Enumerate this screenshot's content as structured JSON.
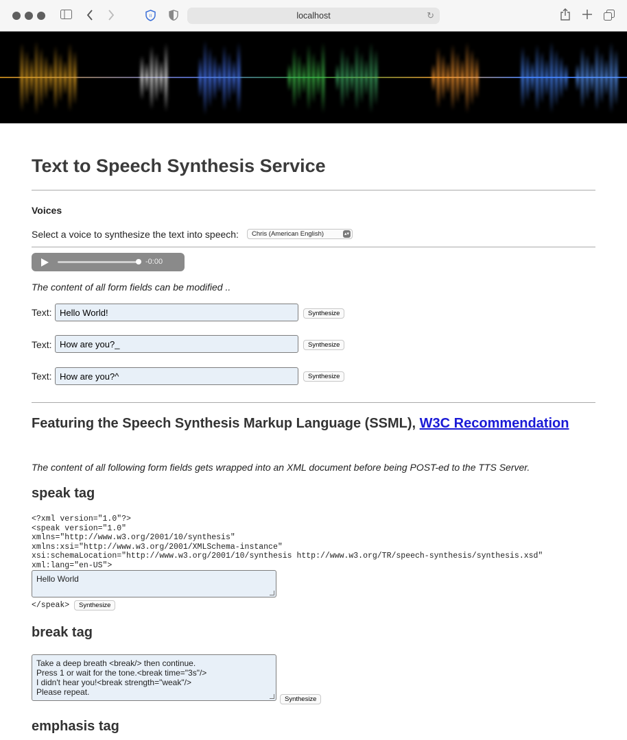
{
  "browser": {
    "url": "localhost"
  },
  "page": {
    "title": "Text to Speech Synthesis Service",
    "voices_heading": "Voices",
    "select_label": "Select a voice to synthesize the text into speech:",
    "selected_voice": "Chris (American English)",
    "player_time": "-0:00",
    "player_progress": 1.0,
    "modifiable_note": "The content of all form fields can be modified ..",
    "text_label": "Text:",
    "synthesize_label": "Synthesize",
    "text_fields": [
      "Hello World!",
      "How are you?_",
      "How are you?^"
    ],
    "ssml_heading_prefix": "Featuring the Speech Synthesis Markup Language (SSML),",
    "ssml_link": "W3C Recommendation",
    "ssml_note": "The content of all following form fields gets wrapped into an XML document before being POST-ed to the TTS Server.",
    "speak_heading": "speak tag",
    "xml_header": "<?xml version=\"1.0\"?>\n<speak version=\"1.0\"\nxmlns=\"http://www.w3.org/2001/10/synthesis\"\nxmlns:xsi=\"http://www.w3.org/2001/XMLSchema-instance\"\nxsi:schemaLocation=\"http://www.w3.org/2001/10/synthesis http://www.w3.org/TR/speech-synthesis/synthesis.xsd\"\nxml:lang=\"en-US\">",
    "speak_text": "Hello World",
    "speak_close": "</speak>",
    "break_heading": "break tag",
    "break_text": "Take a deep breath <break/> then continue.\nPress 1 or wait for the tone.<break time=\"3s\"/>\nI didn't hear you!<break strength=\"weak\"/>\nPlease repeat.",
    "emphasis_heading": "emphasis tag"
  }
}
